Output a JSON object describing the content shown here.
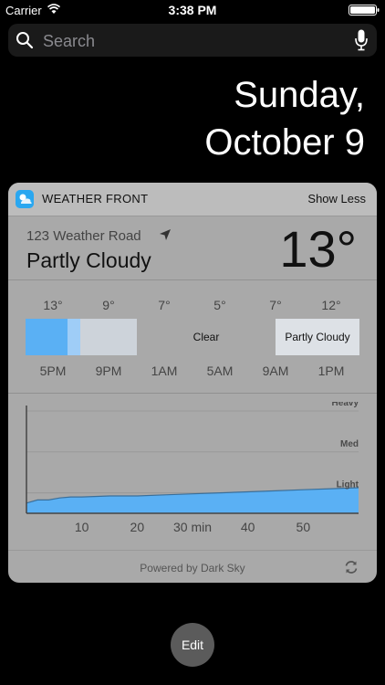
{
  "status_bar": {
    "carrier": "Carrier",
    "time": "3:38 PM"
  },
  "search": {
    "placeholder": "Search"
  },
  "date": {
    "line1": "Sunday,",
    "line2": "October 9"
  },
  "widget": {
    "app_name": "WEATHER FRONT",
    "toggle_label": "Show Less",
    "location": "123 Weather Road",
    "condition": "Partly Cloudy",
    "temperature": "13°",
    "hours": [
      {
        "temp": "13°",
        "time": "5PM"
      },
      {
        "temp": "9°",
        "time": "9PM"
      },
      {
        "temp": "7°",
        "time": "1AM"
      },
      {
        "temp": "5°",
        "time": "5AM"
      },
      {
        "temp": "7°",
        "time": "9AM"
      },
      {
        "temp": "12°",
        "time": "1PM"
      }
    ],
    "timeline_labels": {
      "clear": "Clear",
      "partly_cloudy": "Partly Cloudy"
    },
    "colors": {
      "rain": "#5ab0f4",
      "light_rain": "#9fcdf7",
      "cloud": "#cdd3da",
      "clear": "#a9a9a9",
      "partly": "#dde1e6"
    },
    "footer": "Powered by Dark Sky"
  },
  "chart_data": {
    "type": "area",
    "x": [
      0,
      2,
      4,
      6,
      8,
      10,
      15,
      20,
      25,
      30,
      35,
      40,
      45,
      50,
      55,
      60
    ],
    "values": [
      0.1,
      0.13,
      0.13,
      0.15,
      0.16,
      0.16,
      0.17,
      0.17,
      0.18,
      0.19,
      0.2,
      0.21,
      0.22,
      0.23,
      0.24,
      0.25
    ],
    "xlabel": "",
    "ylabel": "",
    "xlim": [
      0,
      60
    ],
    "ylim": [
      0,
      1
    ],
    "x_ticks": [
      {
        "value": 10,
        "label": "10"
      },
      {
        "value": 20,
        "label": "20"
      },
      {
        "value": 30,
        "label": "30 min"
      },
      {
        "value": 40,
        "label": "40"
      },
      {
        "value": 50,
        "label": "50"
      }
    ],
    "y_ticks": [
      {
        "value": 1,
        "label": "Heavy"
      },
      {
        "value": 0.6,
        "label": "Med"
      },
      {
        "value": 0.2,
        "label": "Light"
      }
    ],
    "grid": true,
    "fill_color": "#5ab0f4"
  },
  "edit_label": "Edit"
}
